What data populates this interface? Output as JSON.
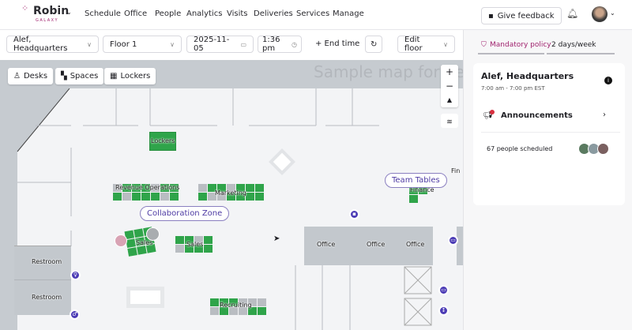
{
  "nav": {
    "brand": "Robin",
    "brand_sub": "GALAXY",
    "items": [
      "Schedule",
      "Office",
      "People",
      "Analytics",
      "Visits",
      "Deliveries",
      "Services",
      "Manage"
    ],
    "feedback": "Give feedback"
  },
  "toolbar": {
    "location": "Alef, Headquarters",
    "floor": "Floor 1",
    "date": "2025-11-05",
    "time": "1:36 pm",
    "end_time": "+ End time",
    "edit_floor": "Edit floor"
  },
  "map": {
    "watermark": "Sample map for de",
    "chips": [
      "Desks",
      "Spaces",
      "Lockers"
    ],
    "labels": {
      "lockers": "Lockers",
      "revenue": "Revenue Operations",
      "marketing": "Marketing",
      "collab": "Collaboration Zone",
      "sales1": "Sales",
      "sales2": "Sales",
      "team_tables": "Team Tables",
      "finance": "Finance",
      "fin_partial": "Fin",
      "recruiting": "Recruiting",
      "office": "Office",
      "restroom": "Restroom"
    },
    "zoom_in": "+",
    "zoom_out": "−"
  },
  "panel": {
    "policy_label": "Mandatory policy",
    "policy_value": "2 days/week",
    "location": "Alef, Headquarters",
    "hours": "7:00 am - 7:00 pm EST",
    "announcements": "Announcements",
    "scheduled": "67 people scheduled"
  },
  "colors": {
    "brand": "#a0226e",
    "desk_available": "#2fa44a",
    "poi": "#4b3bb5"
  }
}
